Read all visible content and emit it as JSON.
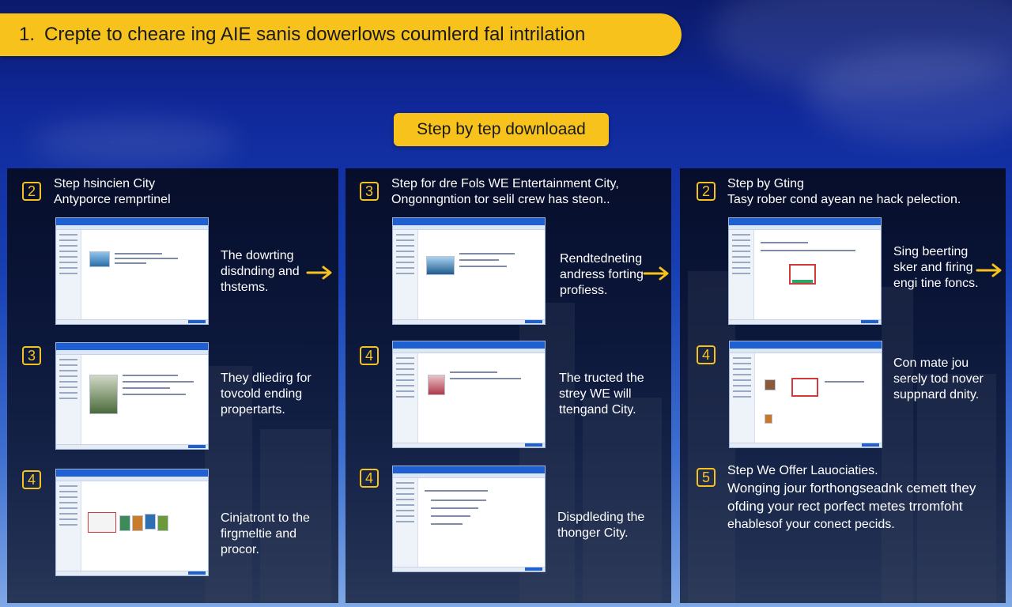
{
  "banner": {
    "number": "1.",
    "text": "Crepte to cheare ing AIE sanis dowerlows coumlerd fal intrilation"
  },
  "sub_button": "Step by tep downloaad",
  "colors": {
    "accent": "#f6c21b",
    "panel": "#0a1230",
    "window_chrome": "#1e5fd1"
  },
  "panels": [
    {
      "badge": "2",
      "title": [
        "Step hsincien City",
        "Antyporce remprtinel"
      ],
      "steps": [
        {
          "badge": "",
          "text": [
            "The dowrting",
            "disdnding and",
            "thstems."
          ],
          "arrow": true
        },
        {
          "badge": "3",
          "text": [
            "They dliedirg for",
            "tovcold ending",
            "propertarts."
          ],
          "arrow": false
        },
        {
          "badge": "4",
          "text": [
            "Cinjatront to the",
            "firgmeltie and",
            "procor."
          ],
          "arrow": false
        }
      ]
    },
    {
      "badge": "3",
      "title": [
        "Step for dre Fols WE Entertainment City,",
        "Ongonngntion tor selil crew has steon.."
      ],
      "steps": [
        {
          "badge": "",
          "text": [
            "Rendtedneting",
            "andress forting",
            "profiess."
          ],
          "arrow": true
        },
        {
          "badge": "4",
          "text": [
            "The tructed the",
            "strey WE  will",
            "ttengand City."
          ],
          "arrow": false
        },
        {
          "badge": "4",
          "text": [
            "Dispdleding the",
            "thonger City."
          ],
          "arrow": false
        }
      ]
    },
    {
      "badge": "2",
      "title": [
        "Step by Gting",
        "Tasy rober cond ayean ne hack pelection."
      ],
      "steps": [
        {
          "badge": "",
          "text": [
            "Sing beerting",
            "sker and firing",
            "engi tine foncs."
          ],
          "arrow": true
        },
        {
          "badge": "4",
          "text": [
            "Con mate jou",
            "serely tod nover",
            "suppnard dnity."
          ],
          "arrow": false
        },
        {
          "badge": "5",
          "text": [
            "Step We Offer Lauociaties.",
            "Wonging jour forthongseadnk cemett they",
            "ofding your rect porfect metes trromfoht",
            "ehablesof your conect pecids."
          ],
          "arrow": false
        }
      ]
    }
  ]
}
